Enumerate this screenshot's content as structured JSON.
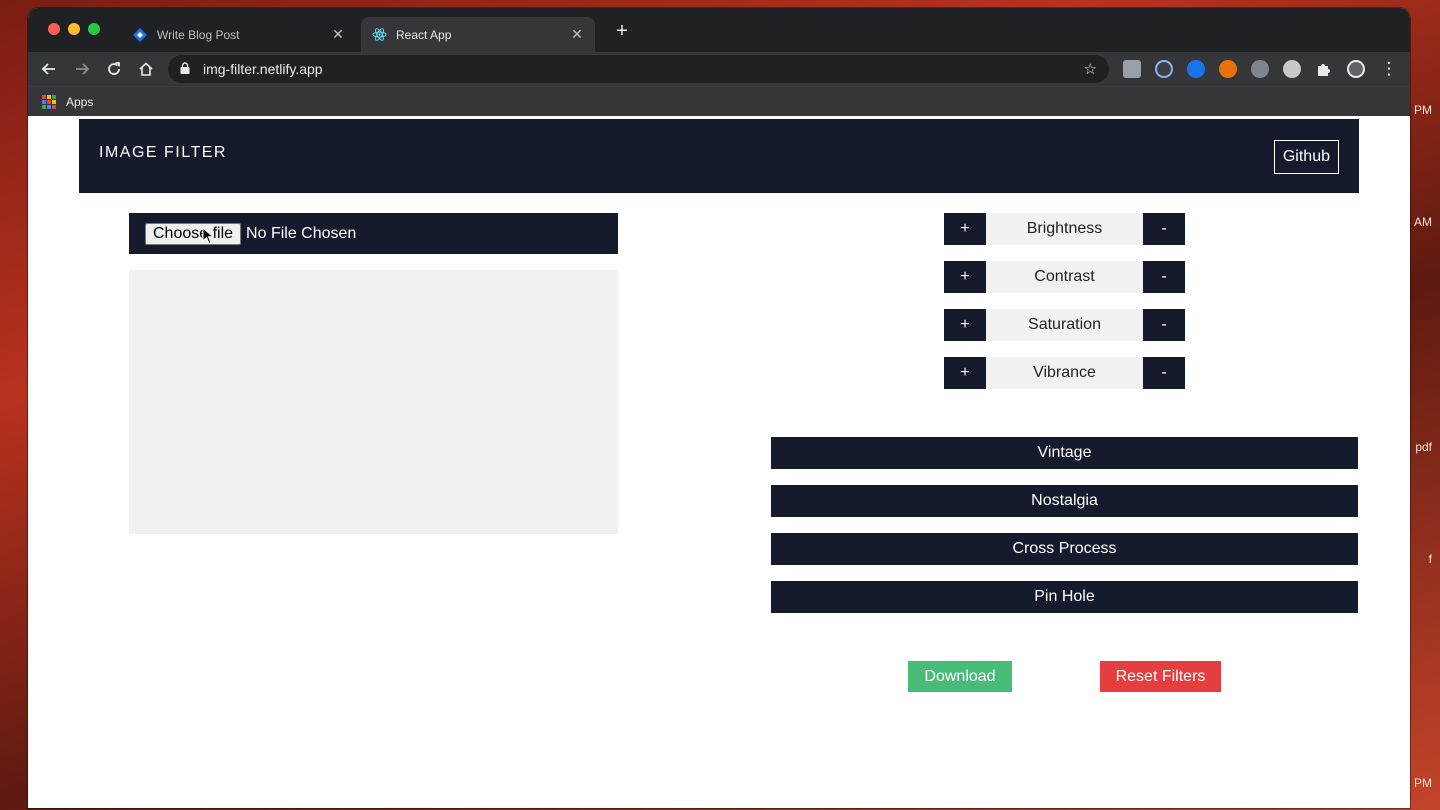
{
  "desktop": {
    "side_labels": [
      "PM",
      "AM",
      "pdf",
      "f",
      "PM"
    ]
  },
  "browser": {
    "tabs": [
      {
        "label": "Write Blog Post",
        "icon": "blue-diamond-icon",
        "active": false
      },
      {
        "label": "React App",
        "icon": "react-icon",
        "active": true
      }
    ],
    "address": "img-filter.netlify.app",
    "bookmarks": {
      "apps_label": "Apps"
    }
  },
  "app": {
    "navbar": {
      "brand": "IMAGE FILTER",
      "github_label": "Github"
    },
    "file_input": {
      "button_label": "Choose file",
      "status": "No File Chosen"
    },
    "adjustments": [
      {
        "label": "Brightness",
        "plus": "+",
        "minus": "-"
      },
      {
        "label": "Contrast",
        "plus": "+",
        "minus": "-"
      },
      {
        "label": "Saturation",
        "plus": "+",
        "minus": "-"
      },
      {
        "label": "Vibrance",
        "plus": "+",
        "minus": "-"
      }
    ],
    "presets": [
      "Vintage",
      "Nostalgia",
      "Cross Process",
      "Pin Hole"
    ],
    "actions": {
      "download_label": "Download",
      "reset_label": "Reset Filters"
    },
    "colors": {
      "navbar_bg": "#151b2c",
      "download": "#48bb78",
      "reset": "#e53e3e",
      "panel": "#f1f1f2"
    }
  }
}
